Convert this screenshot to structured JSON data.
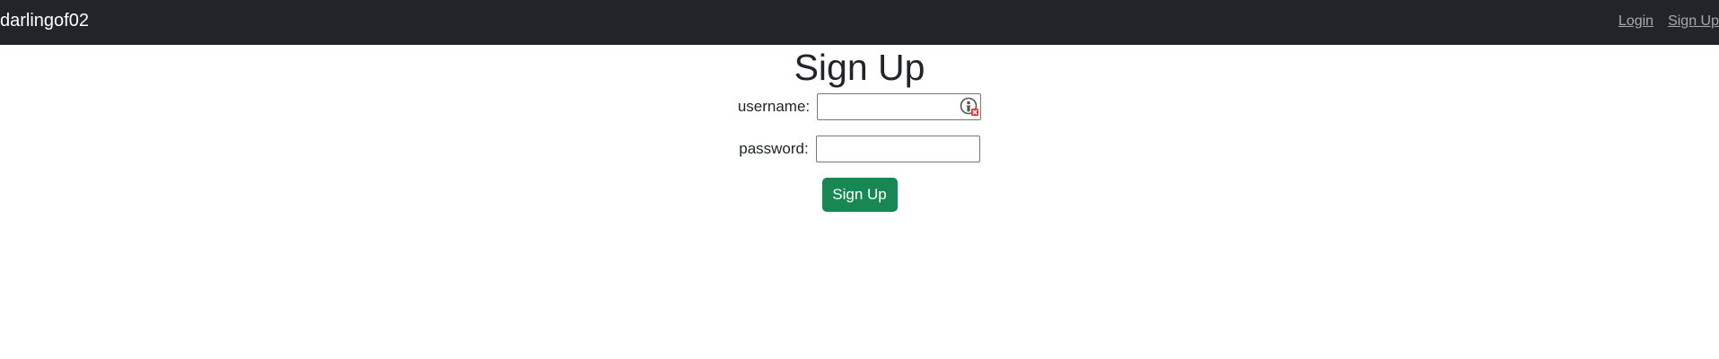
{
  "navbar": {
    "brand": "darlingof02",
    "links": [
      {
        "label": "Login"
      },
      {
        "label": "Sign Up"
      }
    ],
    "background_color": "#212529"
  },
  "main": {
    "title": "Sign Up",
    "fields": {
      "username": {
        "label": "username:",
        "value": ""
      },
      "password": {
        "label": "password:",
        "value": ""
      }
    },
    "submit_label": "Sign Up",
    "submit_color": "#198754"
  },
  "icons": {
    "password_manager": "password-manager-icon"
  }
}
